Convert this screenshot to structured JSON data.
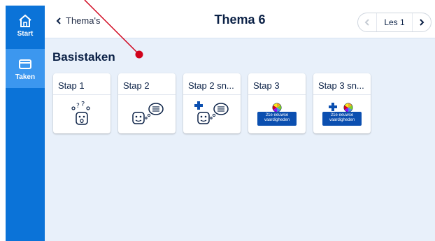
{
  "sidebar": {
    "items": [
      {
        "label": "Start",
        "icon": "home-icon"
      },
      {
        "label": "Taken",
        "icon": "window-icon"
      }
    ]
  },
  "header": {
    "back_label": "Thema's",
    "title": "Thema 6",
    "les_label": "Les 1"
  },
  "main": {
    "section_title": "Basistaken",
    "tiles": [
      {
        "label": "Stap 1",
        "icon": "face-question-icon"
      },
      {
        "label": "Stap 2",
        "icon": "face-speech-icon"
      },
      {
        "label": "Stap 2 sn...",
        "icon": "plus-face-speech-icon"
      },
      {
        "label": "Stap 3",
        "icon": "21e-eeuwse-badge-icon",
        "badge_text_1": "21e eeuwse",
        "badge_text_2": "vaardigheden"
      },
      {
        "label": "Stap 3 sn...",
        "icon": "plus-21e-eeuwse-badge-icon",
        "badge_text_1": "21e eeuwse",
        "badge_text_2": "vaardigheden"
      }
    ]
  },
  "colors": {
    "sidebar": "#0b73d8",
    "sidebar_active": "#3c97ef",
    "content_bg": "#e8f0fa",
    "title_text": "#0b2146",
    "annotation": "#d0021b"
  }
}
